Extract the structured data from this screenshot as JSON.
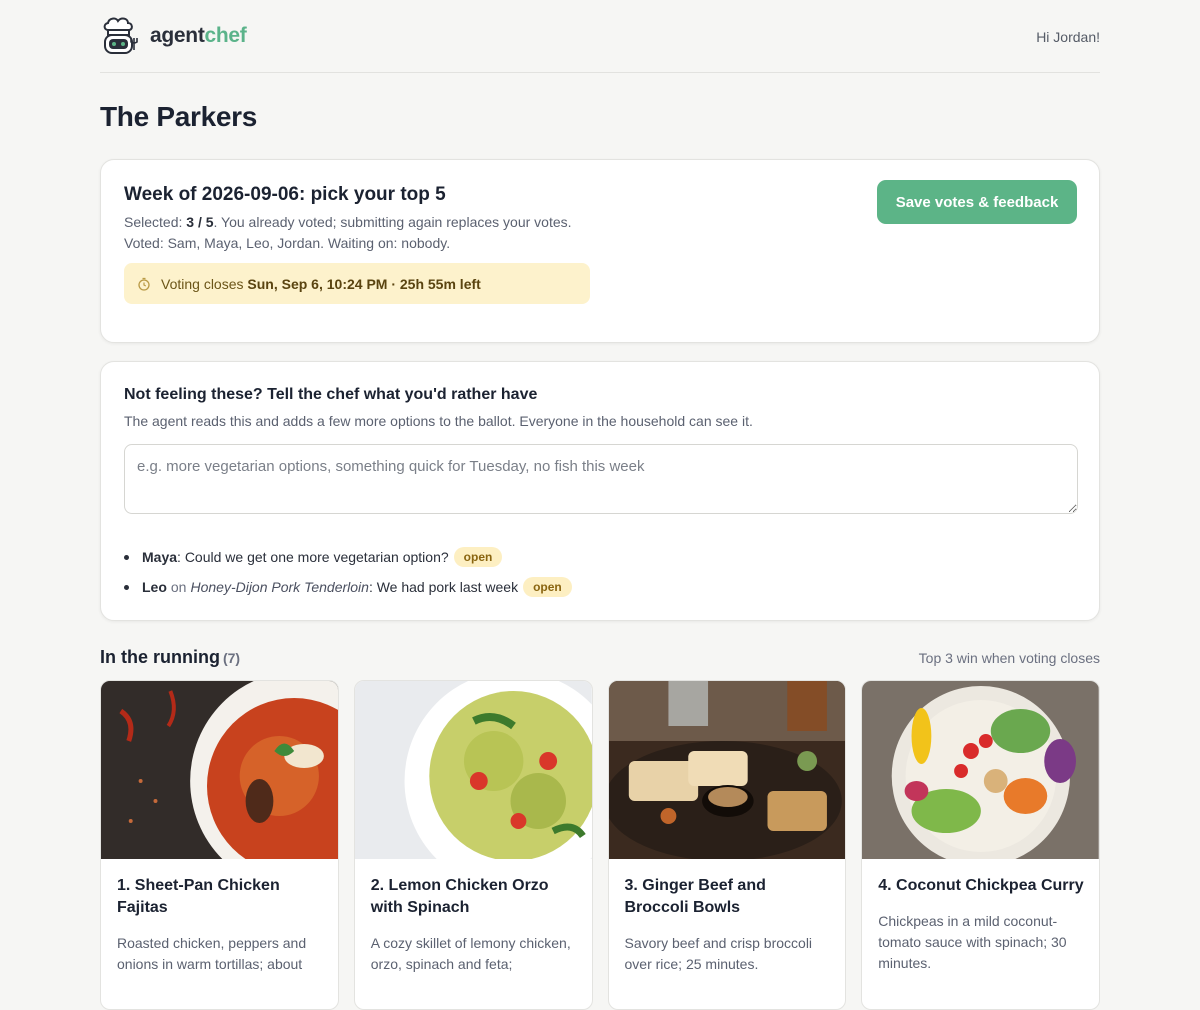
{
  "header": {
    "logo_word1": "agent",
    "logo_word2": "chef",
    "greeting": "Hi Jordan!"
  },
  "page_title": "The Parkers",
  "ballot": {
    "title": "Week of 2026-09-06: pick your top 5",
    "selected_label": "Selected: ",
    "selected_value": "3 / 5",
    "selected_suffix": ". You already voted; submitting again replaces your votes.",
    "voted_line": "Voted: Sam, Maya, Leo, Jordan. Waiting on: nobody.",
    "deadline_prefix": "Voting closes ",
    "deadline_strong": "Sun, Sep 6, 10:24 PM · 25h 55m left",
    "save_label": "Save votes & feedback"
  },
  "feedback": {
    "title": "Not feeling these? Tell the chef what you'd rather have",
    "subtitle": "The agent reads this and adds a few more options to the ballot. Everyone in the household can see it.",
    "placeholder": "e.g. more vegetarian options, something quick for Tuesday, no fish this week",
    "items": [
      {
        "who": "Maya",
        "sep": ": ",
        "text": "Could we get one more vegetarian option?",
        "status": "open"
      },
      {
        "who": "Leo",
        "on": "on",
        "dish": "Honey-Dijon Pork Tenderloin",
        "sep": ": ",
        "text": "We had pork last week",
        "status": "open"
      }
    ]
  },
  "running": {
    "title": "In the running",
    "count": "(7)",
    "note": "Top 3 win when voting closes",
    "dishes": [
      {
        "name": "1. Sheet-Pan Chicken Fajitas",
        "desc": "Roasted chicken, peppers and onions in warm tortillas; about"
      },
      {
        "name": "2. Lemon Chicken Orzo with Spinach",
        "desc": "A cozy skillet of lemony chicken, orzo, spinach and feta;"
      },
      {
        "name": "3. Ginger Beef and Broccoli Bowls",
        "desc": "Savory beef and crisp broccoli over rice; 25 minutes."
      },
      {
        "name": "4. Coconut Chickpea Curry",
        "desc": "Chickpeas in a mild coconut-tomato sauce with spinach; 30 minutes."
      }
    ]
  },
  "colors": {
    "accent": "#5cb487",
    "deadline_bg": "#fdf2cc",
    "badge_bg": "#fdefc2"
  }
}
